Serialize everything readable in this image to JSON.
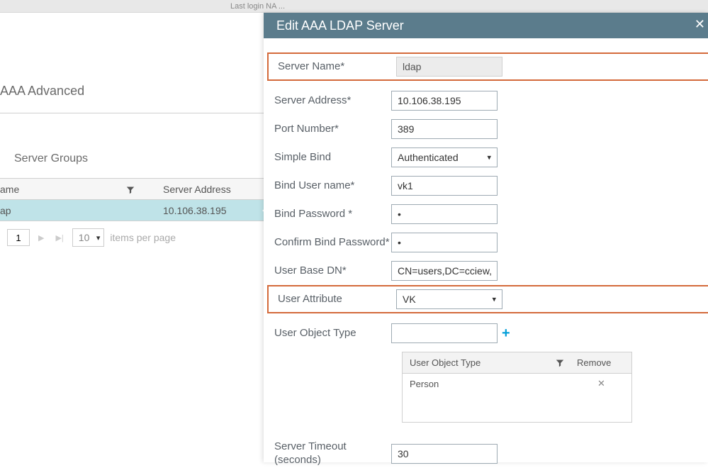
{
  "topbar": {
    "last_login": "Last login NA ..."
  },
  "background": {
    "section_title": "AAA Advanced",
    "subsection_title": "Server Groups",
    "table": {
      "columns": {
        "name": "ame",
        "address": "Server Address"
      },
      "rows": [
        {
          "name": "ap",
          "address": "10.106.38.195"
        }
      ]
    },
    "pager": {
      "page": "1",
      "per_page": "10",
      "label": "items per page"
    }
  },
  "modal": {
    "title": "Edit AAA LDAP Server",
    "fields": {
      "server_name": {
        "label": "Server Name*",
        "value": "ldap"
      },
      "server_address": {
        "label": "Server Address*",
        "value": "10.106.38.195"
      },
      "port_number": {
        "label": "Port Number*",
        "value": "389"
      },
      "simple_bind": {
        "label": "Simple Bind",
        "value": "Authenticated"
      },
      "bind_username": {
        "label": "Bind User name*",
        "value": "vk1"
      },
      "bind_password": {
        "label": "Bind Password *",
        "value": "•"
      },
      "confirm_bind_password": {
        "label": "Confirm Bind Password*",
        "value": "•"
      },
      "user_base_dn": {
        "label": "User Base DN*",
        "value": "CN=users,DC=cciew,DC"
      },
      "user_attribute": {
        "label": "User Attribute",
        "value": "VK"
      },
      "user_object_type": {
        "label": "User Object Type",
        "value": ""
      },
      "server_timeout": {
        "label": "Server Timeout (seconds)",
        "value": "30"
      }
    },
    "object_type_table": {
      "columns": {
        "type": "User Object Type",
        "remove": "Remove"
      },
      "rows": [
        {
          "type": "Person"
        }
      ]
    }
  }
}
